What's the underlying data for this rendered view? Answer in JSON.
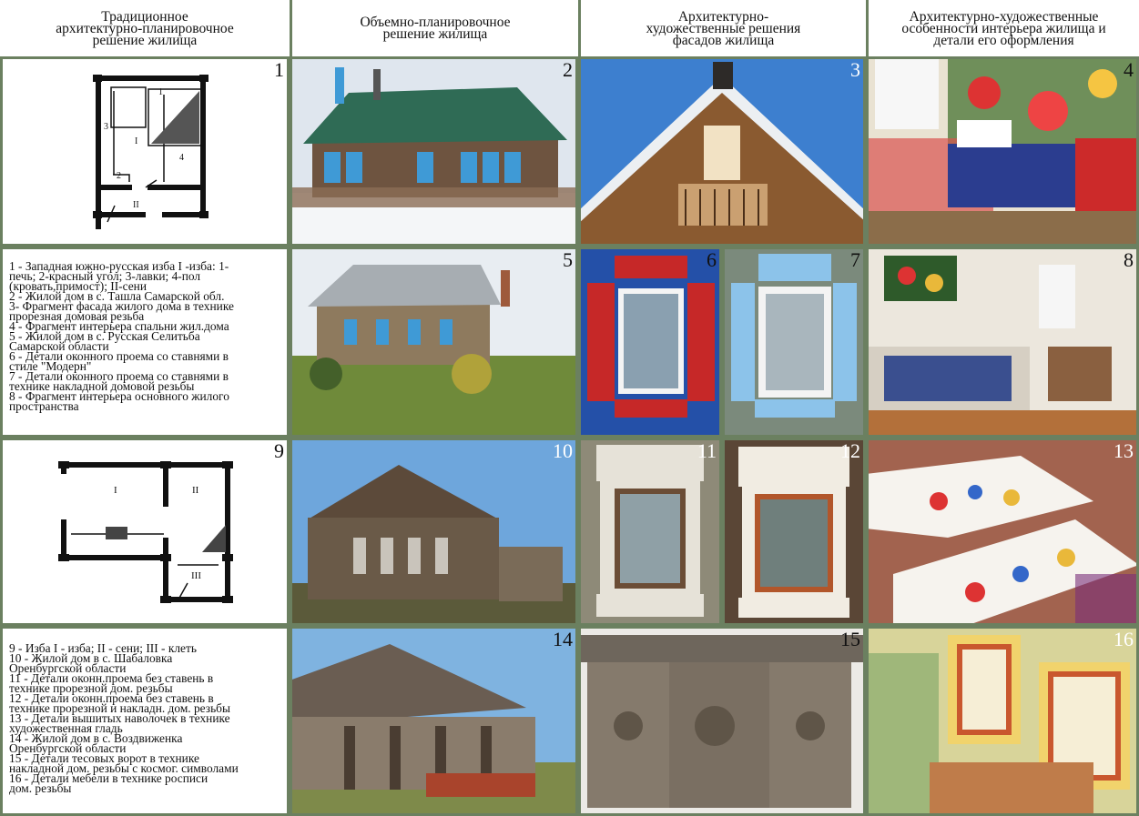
{
  "headers": [
    "Традиционное\nархитектурно-планировочное\nрешение жилища",
    "Объемно-планировочное\nрешение жилища",
    "Архитектурно-\nхудожественные решения\nфасадов жилища",
    "Архитектурно-художественные\nособенности интерьера жилища и\nдетали его оформления"
  ],
  "numbers": [
    "1",
    "2",
    "3",
    "4",
    "5",
    "6",
    "7",
    "8",
    "9",
    "10",
    "11",
    "12",
    "13",
    "14",
    "15",
    "16"
  ],
  "plan1_labels": [
    "1",
    "3",
    "I",
    "4",
    "2",
    "II"
  ],
  "plan9_labels": [
    "I",
    "II",
    "III"
  ],
  "caption_block_1": "1 - Западная южно-русская изба I -изба: 1-\nпечь; 2-красный угол; 3-лавки; 4-пол\n(кровать,примост); II-сени\n 2 - Жилой дом в с. Ташла Самарской обл.\n 3- Фрагмент фасада жилого дома в технике\nпрорезная домовая резьба\n 4 - Фрагмент интерьера спальни жил.дома\n 5 - Жилой дом в с. Русская Селитьба\nСамарской области\n 6 - Детали оконного проема со ставнями в\nстиле \"Модерн\"\n 7 - Детали оконного проема со ставнями в\nтехнике накладной домовой резьбы\n 8 - Фрагмент интерьера основного жилого\nпространства",
  "caption_block_2": "9 - Изба I - изба; II - сени; III - клеть\n 10 - Жилой дом в с. Шабаловка\nОренбургской области\n 11 - Детали оконн.проема без ставень в\nтехнике прорезной дом. резьбы\n 12 - Детали оконн.проема без ставень в\nтехнике прорезной и накладн. дом. резьбы\n 13 - Детали вышитых наволочек в технике\nхудожественная гладь\n 14 - Жилой дом в с. Воздвиженка\nОренбургской области\n 15 - Детали тесовых ворот в технике\nнакладной дом. резьбы с космог. символами\n 16 - Детали мебели в технике росписи\nдом. резьбы",
  "colors": {
    "frame": "#6b8060",
    "sky": "#8fb4dc",
    "snow": "#eef2f6",
    "wood": "#6b4a32",
    "roof_green": "#2f6b55",
    "blue_trim": "#3f9ad6",
    "red_shutter": "#c62828"
  }
}
